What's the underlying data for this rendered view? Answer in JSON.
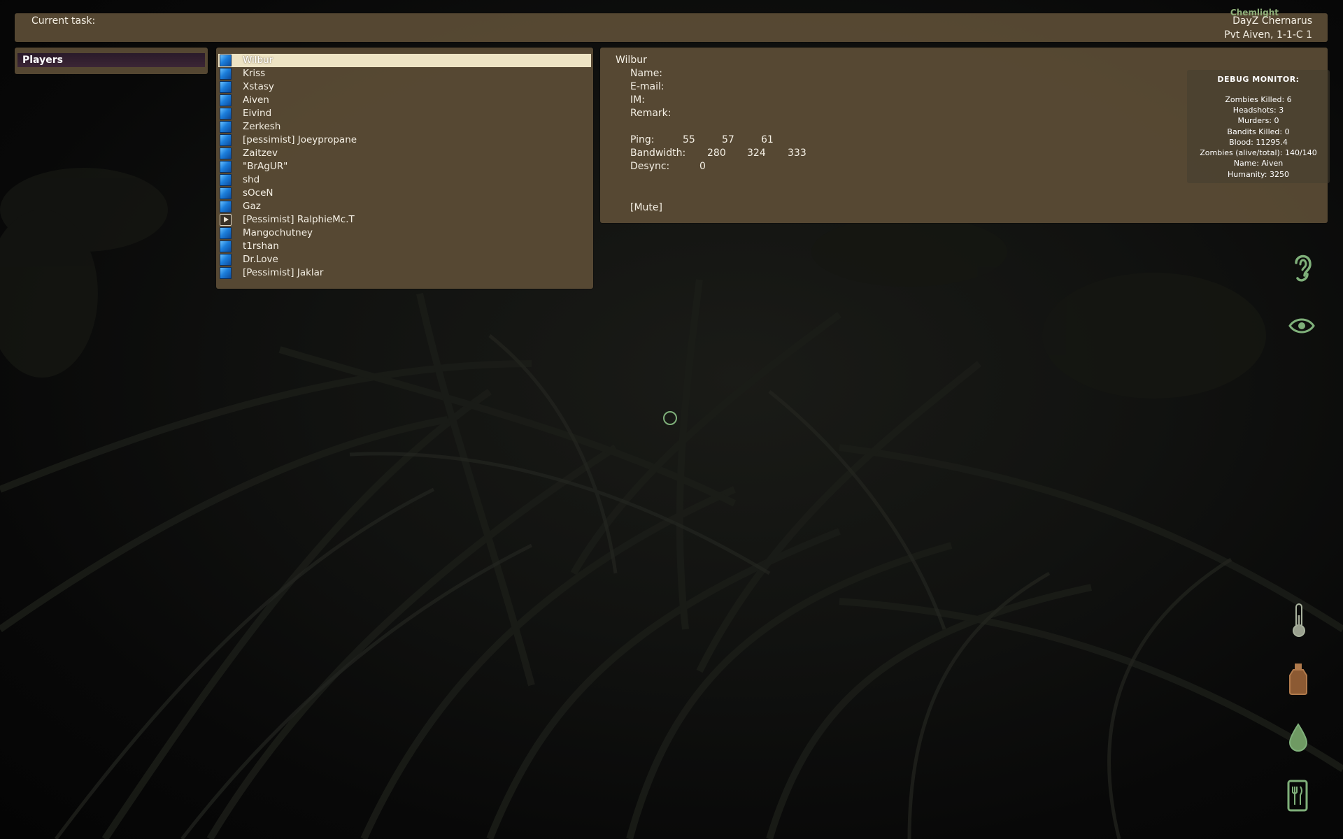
{
  "top_bar": {
    "task_label": "Current task:",
    "server_name": "DayZ Chernarus",
    "player_rank": "Pvt Aiven, 1-1-C 1",
    "chemlight": "Chemlight"
  },
  "tabs": {
    "players_label": "Players"
  },
  "players": [
    {
      "name": "Wilbur",
      "icon": "blue",
      "selected": true
    },
    {
      "name": "Kriss",
      "icon": "blue"
    },
    {
      "name": "Xstasy",
      "icon": "blue"
    },
    {
      "name": "Aiven",
      "icon": "blue"
    },
    {
      "name": "Eivind",
      "icon": "blue"
    },
    {
      "name": "Zerkesh",
      "icon": "blue"
    },
    {
      "name": "[pessimist]  Joeypropane",
      "icon": "blue"
    },
    {
      "name": "Zaitzev",
      "icon": "blue"
    },
    {
      "name": "\"BrAgUR\"",
      "icon": "blue"
    },
    {
      "name": "shd",
      "icon": "blue"
    },
    {
      "name": "sOceN",
      "icon": "blue"
    },
    {
      "name": "Gaz",
      "icon": "blue"
    },
    {
      "name": "[Pessimist]  RalphieMc.T",
      "icon": "speaker"
    },
    {
      "name": "Mangochutney",
      "icon": "blue"
    },
    {
      "name": "t1rshan",
      "icon": "blue"
    },
    {
      "name": "Dr.Love",
      "icon": "blue"
    },
    {
      "name": "[Pessimist]  Jaklar",
      "icon": "blue"
    }
  ],
  "detail": {
    "title": "Wilbur",
    "name_label": "Name:",
    "email_label": "E-mail:",
    "im_label": "IM:",
    "remark_label": "Remark:",
    "ping_label": "Ping:",
    "ping_values": [
      "55",
      "57",
      "61"
    ],
    "bandwidth_label": "Bandwidth:",
    "bandwidth_values": [
      "280",
      "324",
      "333"
    ],
    "desync_label": "Desync:",
    "desync_value": "0",
    "mute_label": "[Mute]"
  },
  "debug_monitor": {
    "title": "DEBUG MONITOR:",
    "lines": [
      "Zombies Killed: 6",
      "Headshots: 3",
      "Murders: 0",
      "Bandits Killed: 0",
      "Blood: 11295.4",
      "Zombies (alive/total): 140/140",
      "Name: Aiven",
      "Humanity: 3250"
    ]
  },
  "hud": {
    "accent_color": "#7fb07a",
    "icons": [
      "ear-icon",
      "eye-icon",
      "thermometer-icon",
      "canteen-icon",
      "blood-drop-icon",
      "food-icon"
    ]
  },
  "colors": {
    "panel": "#5c4d36",
    "selected_row": "#eee4c4",
    "tab_active": "#2a1a2a",
    "player_icon": "#1b7ddb"
  }
}
